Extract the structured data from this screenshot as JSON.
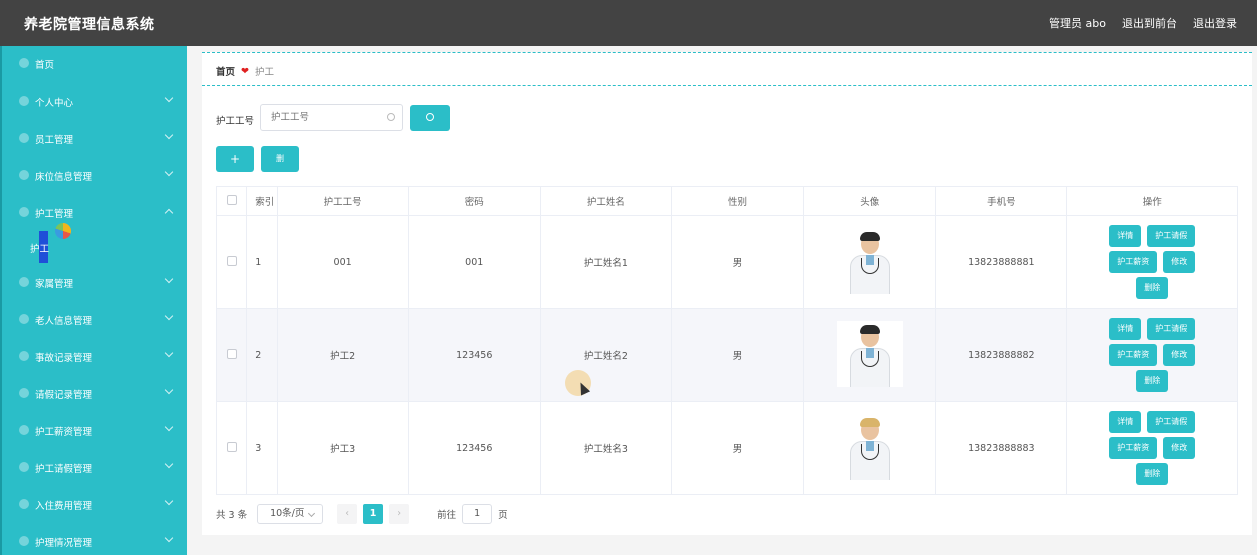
{
  "header": {
    "app_title": "养老院管理信息系统",
    "admin_label": "管理员 abo",
    "to_front": "退出到前台",
    "logout": "退出登录"
  },
  "sidebar": {
    "items": [
      {
        "label": "首页",
        "icon": "home-icon",
        "chevron": false
      },
      {
        "label": "个人中心",
        "icon": "user-icon",
        "chevron": true
      },
      {
        "label": "员工管理",
        "icon": "staff-icon",
        "chevron": true
      },
      {
        "label": "床位信息管理",
        "icon": "bed-icon",
        "chevron": true
      },
      {
        "label": "护工管理",
        "icon": "nurse-icon",
        "chevron": true,
        "expanded": true
      },
      {
        "label": "家属管理",
        "icon": "family-icon",
        "chevron": true
      },
      {
        "label": "老人信息管理",
        "icon": "elder-icon",
        "chevron": true
      },
      {
        "label": "事故记录管理",
        "icon": "incident-icon",
        "chevron": true
      },
      {
        "label": "请假记录管理",
        "icon": "leave-icon",
        "chevron": true
      },
      {
        "label": "护工薪资管理",
        "icon": "salary-icon",
        "chevron": true
      },
      {
        "label": "护工请假管理",
        "icon": "nurse-leave-icon",
        "chevron": true
      },
      {
        "label": "入住费用管理",
        "icon": "fee-icon",
        "chevron": true
      },
      {
        "label": "护理情况管理",
        "icon": "care-icon",
        "chevron": true
      }
    ],
    "sub_item": "护工"
  },
  "breadcrumb": {
    "home": "首页",
    "heart": "❤",
    "current": "护工"
  },
  "search": {
    "label": "护工工号",
    "placeholder": "护工工号"
  },
  "toolbar": {
    "add_label": "+",
    "delete_label": "删"
  },
  "table": {
    "headers": [
      "索引",
      "护工工号",
      "密码",
      "护工姓名",
      "性别",
      "头像",
      "手机号",
      "操作"
    ],
    "rows": [
      {
        "index": "1",
        "id": "001",
        "password": "001",
        "name": "护工姓名1",
        "gender": "男",
        "phone": "13823888881"
      },
      {
        "index": "2",
        "id": "护工2",
        "password": "123456",
        "name": "护工姓名2",
        "gender": "男",
        "phone": "13823888882"
      },
      {
        "index": "3",
        "id": "护工3",
        "password": "123456",
        "name": "护工姓名3",
        "gender": "男",
        "phone": "13823888883"
      }
    ],
    "actions": {
      "detail": "详情",
      "leave": "护工请假",
      "salary": "护工薪资",
      "edit": "修改",
      "delete": "删除"
    }
  },
  "pagination": {
    "total": "共 3 条",
    "page_size": "10条/页",
    "prev": "‹",
    "current_page": "1",
    "next": "›",
    "jump_label": "前往",
    "jump_value": "1",
    "page_suffix": "页"
  },
  "colors": {
    "accent": "#2bbec8",
    "header_bg": "#434343",
    "pager_active": "#2bbec8"
  }
}
